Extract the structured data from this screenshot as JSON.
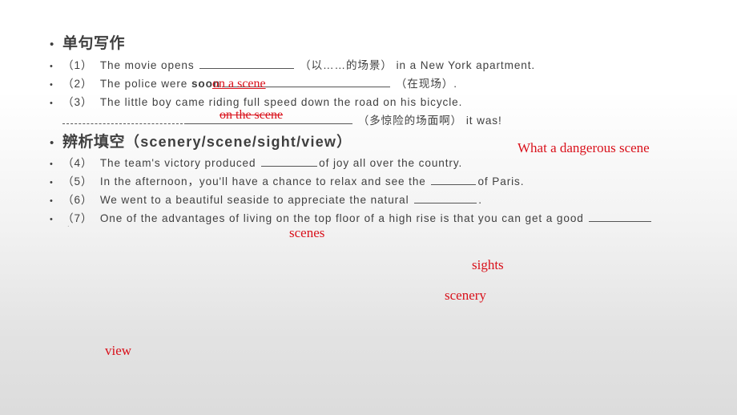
{
  "slide": {
    "background_top": "#ffffff",
    "background_bottom": "#dcdcdc",
    "text_color": "#404040",
    "answer_color": "#d9101a"
  },
  "sections": {
    "heading_1": "单句写作",
    "heading_2_cn": "辨析填空",
    "heading_2_en": "（scenery/scene/sight/view）"
  },
  "questions": {
    "q1": {
      "number": "（1）",
      "before": "The movie opens",
      "after": "（以……的场景）",
      "tail": "in a New York apartment."
    },
    "q2": {
      "number": "（2）",
      "before": "The police were",
      "overlap_black": "soon",
      "after": "（在现场）."
    },
    "q3": {
      "number": "（3）",
      "text": "The little boy came riding full speed down the road on his bicycle.",
      "line2_after": "（多惊险的场面啊）",
      "line2_tail": "it was!"
    },
    "q4": {
      "number": "（4）",
      "before": "The team's victory produced",
      "after": "of joy all over the country."
    },
    "q5": {
      "number": "（5）",
      "before": "In the afternoon，you'll have a chance to relax and see the",
      "after": "of Paris."
    },
    "q6": {
      "number": "（6）",
      "before": "We went to a beautiful seaside to appreciate the natural",
      "after": "."
    },
    "q7": {
      "number": "（7）",
      "before": "One of the advantages of living on the top floor of a high rise is that you can get a good"
    }
  },
  "answers": {
    "a2": "on a scene",
    "a3_inline": "on the scene",
    "a3_exclaim": "What a dangerous scene",
    "a4": "scenes",
    "a5": "sights",
    "a6": "scenery",
    "a7": "view",
    "stray_mark": "."
  }
}
